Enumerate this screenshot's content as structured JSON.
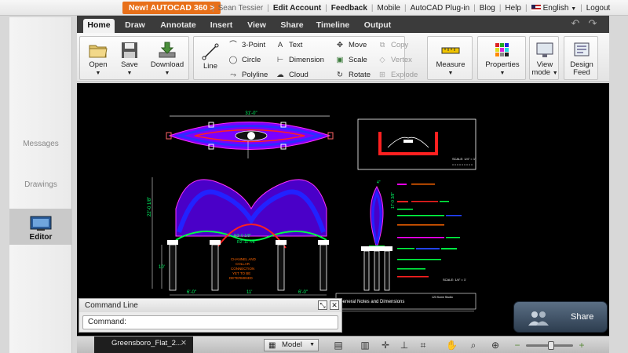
{
  "site_bar": {
    "promo": "New! AUTOCAD 360  >",
    "user": "Sean Tessier",
    "links": [
      "Edit Account",
      "Feedback",
      "Mobile",
      "AutoCAD Plug-in",
      "Blog",
      "Help"
    ],
    "language": "English",
    "logout": "Logout"
  },
  "left_nav": {
    "items": [
      {
        "label": "Messages",
        "active": false
      },
      {
        "label": "Drawings",
        "active": false
      },
      {
        "label": "Editor",
        "active": true
      }
    ]
  },
  "ribbon_tabs": [
    "Home",
    "Draw",
    "Annotate",
    "Insert",
    "View",
    "Share",
    "Timeline",
    "Output"
  ],
  "active_tab": "Home",
  "ribbon": {
    "open": "Open",
    "save": "Save",
    "download": "Download",
    "line": "Line",
    "three_point": "3-Point",
    "circle": "Circle",
    "polyline": "Polyline",
    "text": "Text",
    "dimension": "Dimension",
    "cloud": "Cloud",
    "move": "Move",
    "scale": "Scale",
    "rotate": "Rotate",
    "copy": "Copy",
    "vertex": "Vertex",
    "explode": "Explode",
    "measure": "Measure",
    "properties": "Properties",
    "view_mode_1": "View",
    "view_mode_2": "mode",
    "design_feed_1": "Design",
    "design_feed_2": "Feed"
  },
  "drawing": {
    "dim_top": "31'-0\"",
    "dim_left": "22'-0 1/8\"",
    "dim_right": "17'-0 3/8\"",
    "dim_small": "4\"",
    "label_r1": "R2'-0 1/8\"",
    "label_r2": "R2'-11 7/8\"",
    "note_center": "CHANNEL AND\nCOLLAR\nCONNECTION\nYET TO BE\nDETERMINED",
    "dim_bottom_left": "6'-0\"",
    "dim_bottom_mid": "11'",
    "dim_bottom_right": "6'-0\"",
    "dim_col": "10'",
    "scale_1": "SCALE: 1/4\" = 1'",
    "scale_2": "SCALE: 1/4\" = 1'",
    "title_block": "General Notes and Dimensions",
    "tb_small": "123 Some Studio"
  },
  "command_line": {
    "title": "Command Line",
    "prompt": "Command:"
  },
  "share_button": "Share",
  "bottom_bar": {
    "file_tab": "Greensboro_Flat_2...",
    "model": "Model"
  },
  "colors": {
    "accent_orange": "#e8701a",
    "tab_bar": "#3b3b3b",
    "canvas": "#000000"
  }
}
